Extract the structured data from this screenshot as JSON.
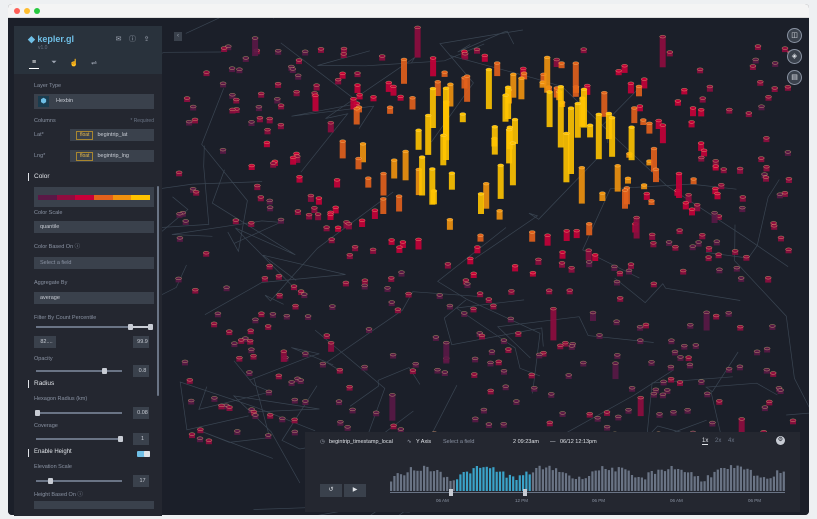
{
  "window": {
    "dots": [
      "#ff5f56",
      "#ffbd2e",
      "#27c93f"
    ]
  },
  "app": {
    "name": "kepler.gl",
    "version": "v1.0"
  },
  "panel": {
    "layer_type_label": "Layer Type",
    "layer_type_value": "Hexbin",
    "columns_label": "Columns",
    "required_label": "* Required",
    "lat_label": "Lat*",
    "lat_tag": "float",
    "lat_value": "begintrip_lat",
    "lng_label": "Lng*",
    "lng_tag": "float",
    "lng_value": "begintrip_lng",
    "color_section": "Color",
    "color_ramp": [
      "#5a1846",
      "#900c3f",
      "#c70039",
      "#e3611c",
      "#f1920e",
      "#ffc300"
    ],
    "color_scale_label": "Color Scale",
    "color_scale_value": "quantile",
    "color_based_on_label": "Color Based On",
    "color_based_on_placeholder": "Select a field",
    "aggregate_by_label": "Aggregate By",
    "aggregate_by_value": "average",
    "filter_percentile_label": "Filter By Count Percentile",
    "filter_percentile_min": "82....",
    "filter_percentile_max": "99.9",
    "opacity_label": "Opacity",
    "opacity_value": "0.8",
    "radius_section": "Radius",
    "hex_radius_label": "Hexagon Radius (km)",
    "hex_radius_value": "0.08",
    "coverage_label": "Coverage",
    "coverage_value": "1",
    "enable_height_label": "Enable Height",
    "elevation_scale_label": "Elevation Scale",
    "elevation_scale_value": "17",
    "height_based_on_label": "Height Based On"
  },
  "timeline": {
    "field": "begintrip_timestamp_local",
    "y_axis_label": "Y Axis",
    "y_axis_placeholder": "Select a field",
    "range_start": "2 09:23am",
    "range_sep": "—",
    "range_end": "06/12 12:13pm",
    "speeds": [
      "1x",
      "2x",
      "4x"
    ],
    "ticks": [
      "06 AM",
      "12 PM",
      "06 PM",
      "06 AM",
      "06 PM"
    ],
    "reset_label": "↺",
    "play_label": "▶"
  },
  "colors": {
    "accent": "#6fbfe6",
    "panel": "#242730",
    "map_bg": "#1b1f29"
  }
}
